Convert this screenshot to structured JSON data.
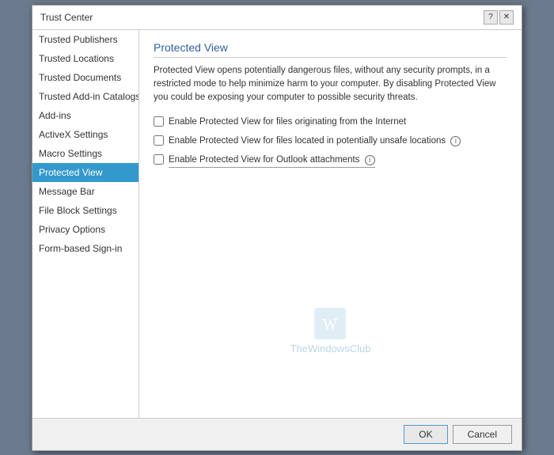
{
  "dialog": {
    "title": "Trust Center",
    "help_icon": "?",
    "close_icon": "✕"
  },
  "sidebar": {
    "items": [
      {
        "id": "trusted-publishers",
        "label": "Trusted Publishers",
        "active": false
      },
      {
        "id": "trusted-locations",
        "label": "Trusted Locations",
        "active": false
      },
      {
        "id": "trusted-documents",
        "label": "Trusted Documents",
        "active": false
      },
      {
        "id": "trusted-add-in-catalog",
        "label": "Trusted Add-in Catalogs",
        "active": false
      },
      {
        "id": "add-ins",
        "label": "Add-ins",
        "active": false
      },
      {
        "id": "activex-settings",
        "label": "ActiveX Settings",
        "active": false
      },
      {
        "id": "macro-settings",
        "label": "Macro Settings",
        "active": false
      },
      {
        "id": "protected-view",
        "label": "Protected View",
        "active": true
      },
      {
        "id": "message-bar",
        "label": "Message Bar",
        "active": false
      },
      {
        "id": "file-block-settings",
        "label": "File Block Settings",
        "active": false
      },
      {
        "id": "privacy-options",
        "label": "Privacy Options",
        "active": false
      },
      {
        "id": "form-based-sign-in",
        "label": "Form-based Sign-in",
        "active": false
      }
    ]
  },
  "main": {
    "panel_title": "Protected View",
    "description": "Protected View opens potentially dangerous files, without any security prompts, in a restricted mode to help minimize harm to your computer. By disabling Protected View you could be exposing your computer to possible security threats.",
    "checkboxes": [
      {
        "id": "cb-internet",
        "label": "Enable Protected View for files originating from the Internet",
        "has_info": false,
        "checked": false
      },
      {
        "id": "cb-unsafe-locations",
        "label": "Enable Protected View for files located in potentially unsafe locations",
        "has_info": true,
        "checked": false
      },
      {
        "id": "cb-outlook",
        "label": "Enable Protected View for Outlook attachments",
        "has_info": true,
        "checked": false,
        "underlined": true
      }
    ],
    "watermark_text": "TheWindowsClub"
  },
  "footer": {
    "ok_label": "OK",
    "cancel_label": "Cancel"
  }
}
